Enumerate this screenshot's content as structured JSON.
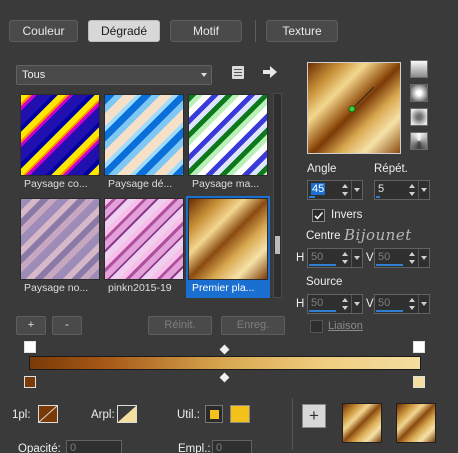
{
  "tabs": [
    "Couleur",
    "Dégradé",
    "Motif",
    "Texture"
  ],
  "category": {
    "value": "Tous"
  },
  "thumbnails": [
    {
      "caption": "Paysage co..."
    },
    {
      "caption": "Paysage dé..."
    },
    {
      "caption": "Paysage ma..."
    },
    {
      "caption": "Paysage no..."
    },
    {
      "caption": "pinkn2015-19"
    },
    {
      "caption": "Premier pla..."
    }
  ],
  "angle": {
    "label": "Angle",
    "value": "45"
  },
  "repeat": {
    "label": "Répét.",
    "value": "5"
  },
  "invert": {
    "label": "Invers",
    "checked": true
  },
  "center": {
    "label": "Centre",
    "h_label": "H",
    "h": "50",
    "v_label": "V",
    "v": "50"
  },
  "source": {
    "label": "Source",
    "h_label": "H",
    "h": "50",
    "v_label": "V",
    "v": "50"
  },
  "link": {
    "label": "Liaison"
  },
  "watermark": "Bijounet",
  "buttons": {
    "add": "+",
    "remove": "-",
    "reset": "Réinit.",
    "save": "Enreg."
  },
  "bottom": {
    "foreground_label": "1pl:",
    "background_label": "Arpl:",
    "user_label": "Util.:",
    "opacity_label": "Opacité:",
    "opacity_value": "0",
    "location_label": "Empl.:",
    "location_value": "0",
    "add_button": "+"
  },
  "colors": {
    "gradient_start": "#7a3a07",
    "gradient_end": "#f4dea0",
    "accent": "#1a6fd0",
    "user_color": "#f2c21a"
  }
}
